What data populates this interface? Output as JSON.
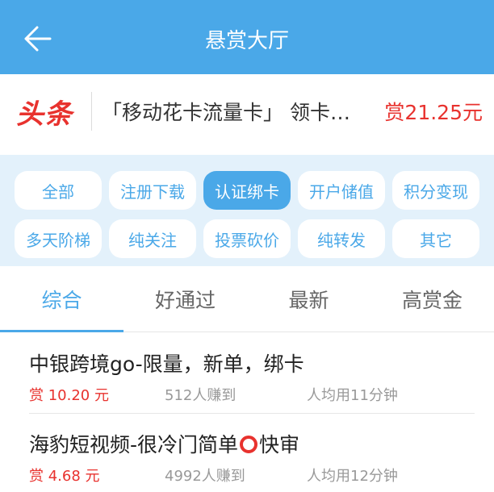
{
  "header": {
    "title": "悬赏大厅"
  },
  "headline": {
    "logo": "头条",
    "text": "「移动花卡流量卡」 领卡…",
    "reward": "赏21.25元"
  },
  "categories": [
    {
      "label": "全部"
    },
    {
      "label": "注册下载"
    },
    {
      "label": "认证绑卡"
    },
    {
      "label": "开户储值"
    },
    {
      "label": "积分变现"
    },
    {
      "label": "多天阶梯"
    },
    {
      "label": "纯关注"
    },
    {
      "label": "投票砍价"
    },
    {
      "label": "纯转发"
    },
    {
      "label": "其它"
    }
  ],
  "active_category": "认证绑卡",
  "tabs": [
    {
      "label": "综合"
    },
    {
      "label": "好通过"
    },
    {
      "label": "最新"
    },
    {
      "label": "高赏金"
    }
  ],
  "active_tab": "综合",
  "tasks": [
    {
      "title": "中银跨境go-限量，新单，绑卡",
      "reward": "赏 10.20 元",
      "count": "512人赚到",
      "time": "人均用11分钟"
    },
    {
      "title_before": "海豹短视频-很冷门简单",
      "title_after": "快审",
      "reward": "赏 4.68 元",
      "count": "4992人赚到",
      "time": "人均用12分钟"
    }
  ],
  "icons": {
    "back": "back-arrow-icon",
    "circle": "red-circle-icon"
  },
  "colors": {
    "primary": "#4aa8e8",
    "accent": "#e8322e",
    "category_bg": "#e3f1fb"
  }
}
